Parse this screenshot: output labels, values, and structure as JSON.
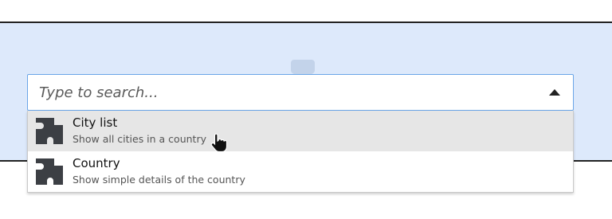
{
  "search": {
    "placeholder": "Type to search...",
    "toggle_icon": "caret-up-icon"
  },
  "options": [
    {
      "title": "City list",
      "description": "Show all cities in a country",
      "icon": "puzzle-piece-icon",
      "highlighted": true
    },
    {
      "title": "Country",
      "description": "Show simple details of the country",
      "icon": "puzzle-piece-icon",
      "highlighted": false
    }
  ],
  "background_icon": "puzzle-piece-icon",
  "pointer_icon": "hand-pointer-icon",
  "colors": {
    "panel_bg": "#dde9fb",
    "focus_border": "#6aa5e8",
    "highlight_bg": "#e6e6e6",
    "icon": "#3c3f44"
  }
}
